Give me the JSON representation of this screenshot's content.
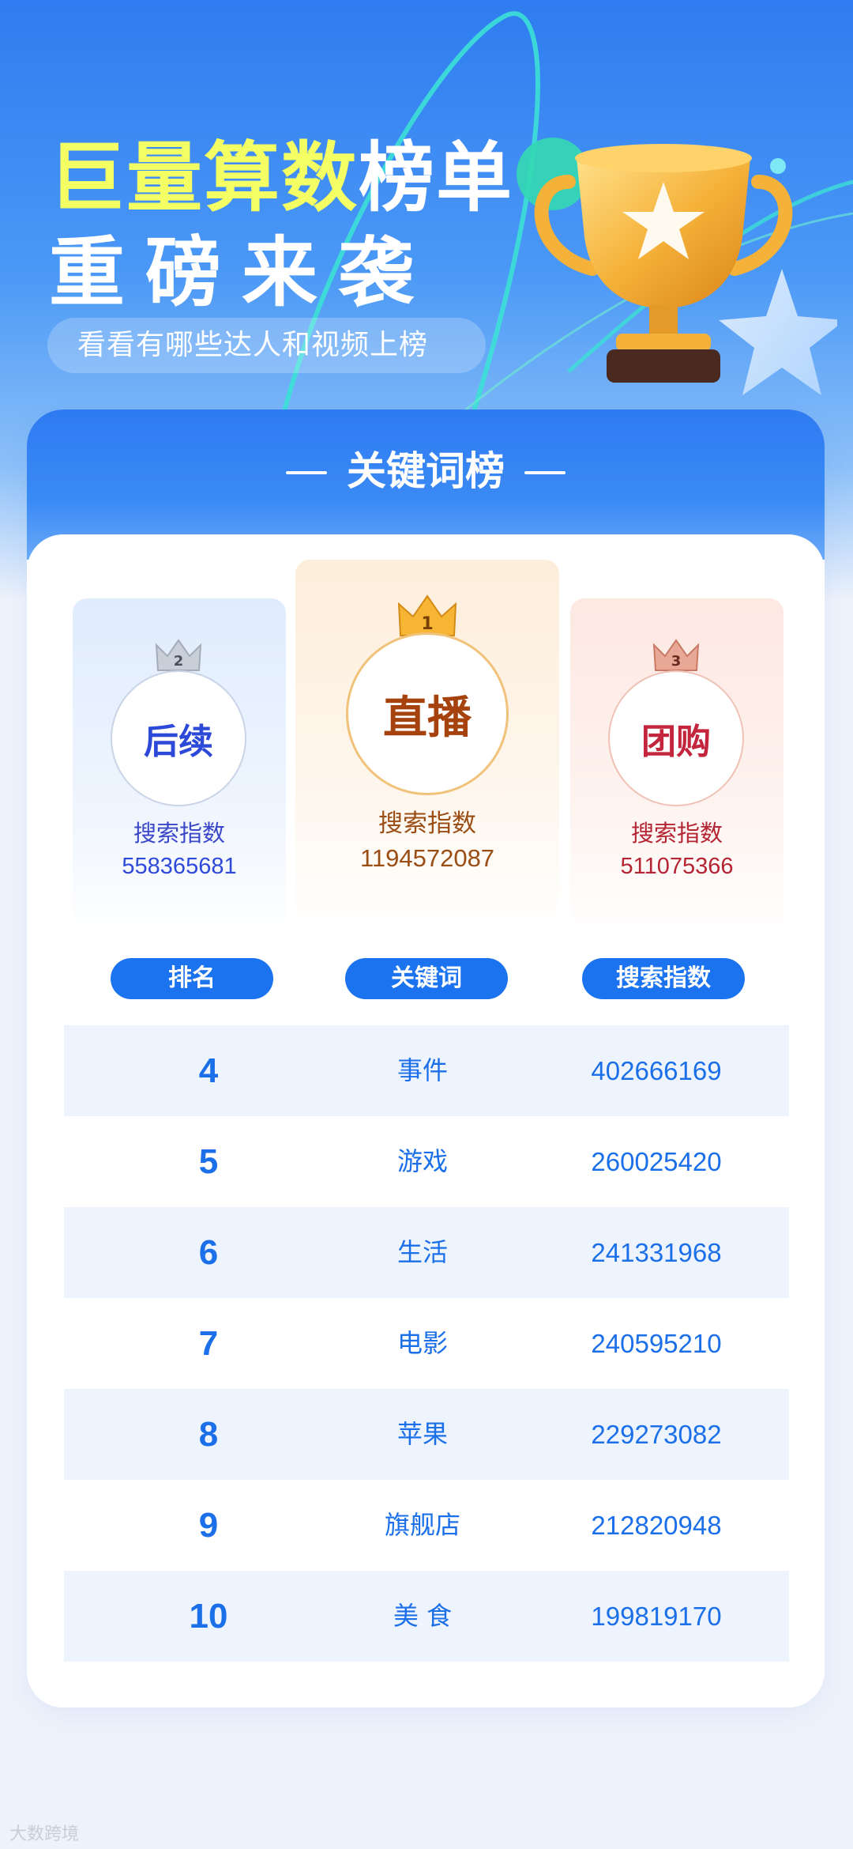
{
  "hero": {
    "title_line1_yellow": "巨量算数",
    "title_line1_white": "榜单",
    "title_line2": "重磅来袭",
    "subtitle": "看看有哪些达人和视频上榜"
  },
  "card": {
    "title": "关键词榜"
  },
  "podium": [
    {
      "rank": "2",
      "keyword": "后续",
      "label": "搜索指数",
      "value": "558365681"
    },
    {
      "rank": "1",
      "keyword": "直播",
      "label": "搜索指数",
      "value": "1194572087"
    },
    {
      "rank": "3",
      "keyword": "团购",
      "label": "搜索指数",
      "value": "511075366"
    }
  ],
  "table": {
    "headers": [
      "排名",
      "关键词",
      "搜索指数"
    ],
    "rows": [
      {
        "rank": "4",
        "keyword": "事件",
        "index": "402666169"
      },
      {
        "rank": "5",
        "keyword": "游戏",
        "index": "260025420"
      },
      {
        "rank": "6",
        "keyword": "生活",
        "index": "241331968"
      },
      {
        "rank": "7",
        "keyword": "电影",
        "index": "240595210"
      },
      {
        "rank": "8",
        "keyword": "苹果",
        "index": "229273082"
      },
      {
        "rank": "9",
        "keyword": "旗舰店",
        "index": "212820948"
      },
      {
        "rank": "10",
        "keyword": "美 食",
        "index": "199819170"
      }
    ]
  },
  "watermark": "大数跨境",
  "colors": {
    "primary_blue": "#1c73ef",
    "title_yellow": "#f4ff63",
    "gold": "#f0c27a",
    "silver_text": "#2d49d8",
    "bronze_text": "#c3263c"
  }
}
